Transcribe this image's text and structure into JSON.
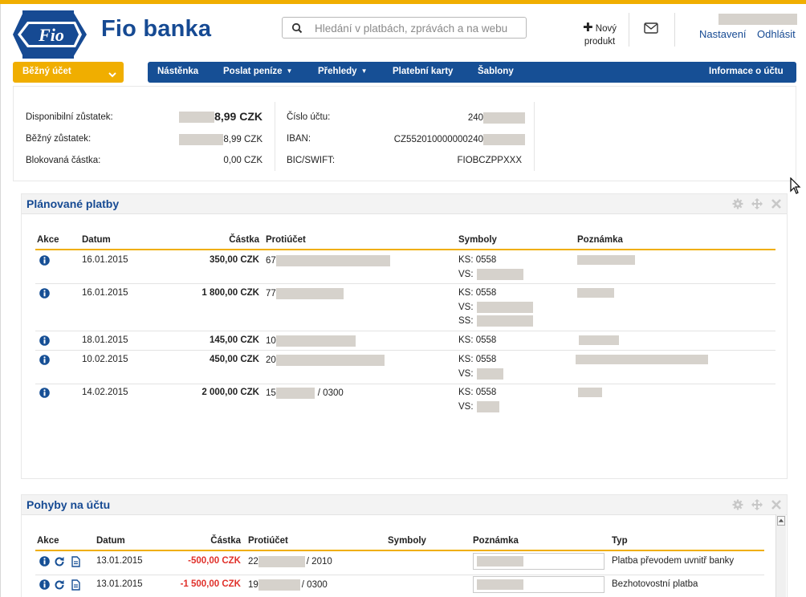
{
  "brand": {
    "name": "Fio banka",
    "logo_text": "Fio",
    "accent": "#f0ae00",
    "primary": "#164f95"
  },
  "search": {
    "placeholder": "Hledání v platbách, zprávách a na webu"
  },
  "header": {
    "new_product": [
      "Nový",
      "produkt"
    ],
    "settings": "Nastavení",
    "logout": "Odhlásit"
  },
  "account_select": {
    "label": "Běžný účet"
  },
  "nav": {
    "items": [
      "Nástěnka",
      "Poslat peníze",
      "Přehledy",
      "Platební karty",
      "Šablony"
    ],
    "right": "Informace o účtu"
  },
  "balance": {
    "available_label": "Disponibilní zůstatek:",
    "available_value": "8,99 CZK",
    "current_label": "Běžný zůstatek:",
    "current_value": "8,99 CZK",
    "blocked_label": "Blokovaná částka:",
    "blocked_value": "0,00 CZK",
    "account_no_label": "Číslo účtu:",
    "account_no_value": "240",
    "iban_label": "IBAN:",
    "iban_value": "CZ552010000000240",
    "bic_label": "BIC/SWIFT:",
    "bic_value": "FIOBCZPPXXX"
  },
  "planned": {
    "title": "Plánované platby",
    "columns": [
      "Akce",
      "Datum",
      "Částka",
      "Protiúčet",
      "Symboly",
      "Poznámka"
    ],
    "rows": [
      {
        "date": "16.01.2015",
        "amount": "350,00 CZK",
        "account": "67",
        "account_suffix": "",
        "symbols": [
          "KS: 0558",
          "VS:"
        ]
      },
      {
        "date": "16.01.2015",
        "amount": "1 800,00 CZK",
        "account": "77",
        "account_suffix": "",
        "symbols": [
          "KS: 0558",
          "VS:",
          "SS:"
        ]
      },
      {
        "date": "18.01.2015",
        "amount": "145,00 CZK",
        "account": "10",
        "account_suffix": "",
        "symbols": [
          "KS: 0558"
        ]
      },
      {
        "date": "10.02.2015",
        "amount": "450,00 CZK",
        "account": "20",
        "account_suffix": "",
        "symbols": [
          "KS: 0558",
          "VS:"
        ]
      },
      {
        "date": "14.02.2015",
        "amount": "2 000,00 CZK",
        "account": "15",
        "account_suffix": "/ 0300",
        "symbols": [
          "KS: 0558",
          "VS:"
        ]
      }
    ]
  },
  "movements": {
    "title": "Pohyby na účtu",
    "columns": [
      "Akce",
      "Datum",
      "Částka",
      "Protiúčet",
      "Symboly",
      "Poznámka",
      "Typ"
    ],
    "rows": [
      {
        "date": "13.01.2015",
        "amount": "-500,00 CZK",
        "account": "22",
        "account_suffix": "/ 2010",
        "type": "Platba převodem uvnitř banky"
      },
      {
        "date": "13.01.2015",
        "amount": "-1 500,00 CZK",
        "account": "19",
        "account_suffix": "/ 0300",
        "type": "Bezhotovostní platba"
      }
    ]
  }
}
